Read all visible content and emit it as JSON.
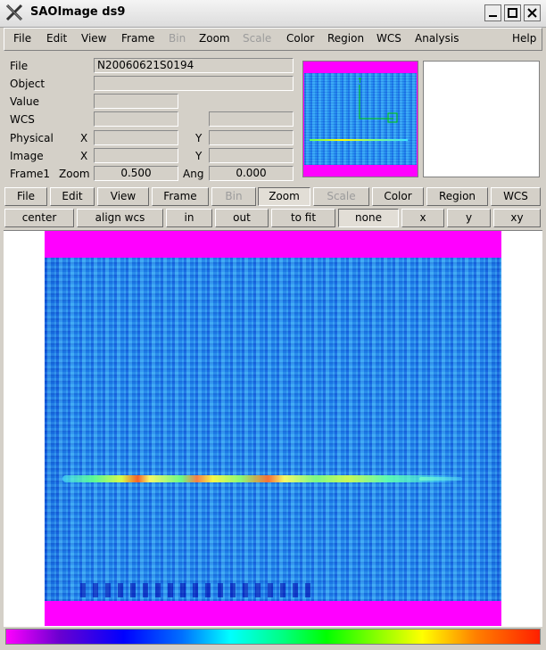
{
  "window": {
    "title": "SAOImage ds9"
  },
  "menubar": {
    "items": [
      {
        "label": "File",
        "enabled": true
      },
      {
        "label": "Edit",
        "enabled": true
      },
      {
        "label": "View",
        "enabled": true
      },
      {
        "label": "Frame",
        "enabled": true
      },
      {
        "label": "Bin",
        "enabled": false
      },
      {
        "label": "Zoom",
        "enabled": true
      },
      {
        "label": "Scale",
        "enabled": false
      },
      {
        "label": "Color",
        "enabled": true
      },
      {
        "label": "Region",
        "enabled": true
      },
      {
        "label": "WCS",
        "enabled": true
      },
      {
        "label": "Analysis",
        "enabled": true
      },
      {
        "label": "Help",
        "enabled": true
      }
    ]
  },
  "info": {
    "file_label": "File",
    "file_value": "N20060621S0194",
    "object_label": "Object",
    "object_value": "",
    "value_label": "Value",
    "value_value": "",
    "wcs_label": "WCS",
    "wcs_value": "",
    "wcs_value2": "",
    "physical_label": "Physical",
    "physical_x_label": "X",
    "physical_x": "",
    "physical_y_label": "Y",
    "physical_y": "",
    "image_label": "Image",
    "image_x_label": "X",
    "image_x": "",
    "image_y_label": "Y",
    "image_y": "",
    "frame_label": "Frame1",
    "zoom_label": "Zoom",
    "zoom_value": "0.500",
    "ang_label": "Ang",
    "ang_value": "0.000"
  },
  "buttonbar": {
    "items": [
      {
        "label": "File",
        "enabled": true,
        "pressed": false
      },
      {
        "label": "Edit",
        "enabled": true,
        "pressed": false
      },
      {
        "label": "View",
        "enabled": true,
        "pressed": false
      },
      {
        "label": "Frame",
        "enabled": true,
        "pressed": false
      },
      {
        "label": "Bin",
        "enabled": false,
        "pressed": false
      },
      {
        "label": "Zoom",
        "enabled": true,
        "pressed": true
      },
      {
        "label": "Scale",
        "enabled": false,
        "pressed": false
      },
      {
        "label": "Color",
        "enabled": true,
        "pressed": false
      },
      {
        "label": "Region",
        "enabled": true,
        "pressed": false
      },
      {
        "label": "WCS",
        "enabled": true,
        "pressed": false
      }
    ]
  },
  "zoombar": {
    "items": [
      {
        "label": "center",
        "pressed": false
      },
      {
        "label": "align wcs",
        "pressed": false
      },
      {
        "label": "in",
        "pressed": false
      },
      {
        "label": "out",
        "pressed": false
      },
      {
        "label": "to fit",
        "pressed": false
      },
      {
        "label": "none",
        "pressed": true
      },
      {
        "label": "x",
        "pressed": false
      },
      {
        "label": "y",
        "pressed": false
      },
      {
        "label": "xy",
        "pressed": false
      }
    ]
  },
  "colors": {
    "blank": "#ff00ff",
    "chrome": "#d4d0c8"
  }
}
